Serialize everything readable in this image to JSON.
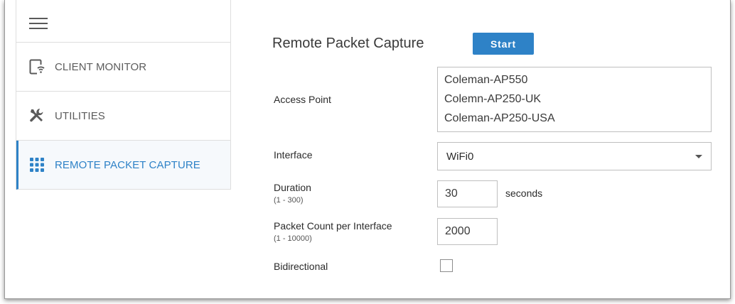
{
  "sidebar": {
    "items": [
      {
        "label": "CLIENT MONITOR",
        "icon": "client-monitor-icon"
      },
      {
        "label": "UTILITIES",
        "icon": "tools-icon"
      },
      {
        "label": "REMOTE PACKET CAPTURE",
        "icon": "grid-icon",
        "active": true
      }
    ]
  },
  "main": {
    "title": "Remote Packet Capture",
    "start_label": "Start",
    "access_point": {
      "label": "Access Point",
      "options": [
        "Coleman-AP550",
        "Colemn-AP250-UK",
        "Coleman-AP250-USA"
      ]
    },
    "interface": {
      "label": "Interface",
      "value": "WiFi0"
    },
    "duration": {
      "label": "Duration",
      "range": "(1 - 300)",
      "value": "30",
      "unit": "seconds"
    },
    "packet_count": {
      "label": "Packet Count per Interface",
      "range": "(1 - 10000)",
      "value": "2000"
    },
    "bidirectional": {
      "label": "Bidirectional",
      "checked": false
    }
  },
  "colors": {
    "accent": "#2e82c7",
    "text": "#3a3a3a",
    "border": "#bfbfbf"
  }
}
